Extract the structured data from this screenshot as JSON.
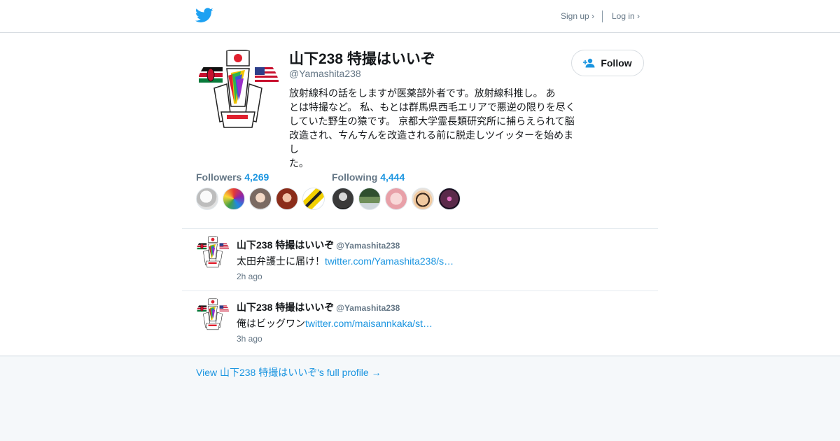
{
  "header": {
    "logo_icon": "twitter-bird-icon",
    "signup_label": "Sign up ›",
    "login_label": "Log in ›"
  },
  "profile": {
    "display_name": "山下238 特撮はいいぞ",
    "screen_name": "@Yamashita238",
    "follow_label": "Follow",
    "follow_icon": "add-person-icon",
    "bio_lines": [
      "放射線科の話をしますが医薬部外者です。放射線科推し。 あ",
      "とは特撮など。 私、もとは群馬県西毛エリアで悪逆の限りを尽く",
      "していた野生の猿です。 京都大学霊長類研究所に捕らえられて脳",
      "改造され、ㄘんㄘんを改造される前に脱走しツイッターを始めまし",
      "た。"
    ]
  },
  "stats": {
    "followers_label": "Followers",
    "followers_count": "4,269",
    "following_label": "Following",
    "following_count": "4,444"
  },
  "tweets": [
    {
      "name": "山下238 特撮はいいぞ",
      "handle": "@Yamashita238",
      "text": "太田弁護士に届け！",
      "link": "twitter.com/Yamashita238/s…",
      "time": "2h ago"
    },
    {
      "name": "山下238 特撮はいいぞ",
      "handle": "@Yamashita238",
      "text": "俺はビッグワン",
      "link": "twitter.com/maisannkaka/st…",
      "time": "3h ago"
    }
  ],
  "footer": {
    "full_profile_link": "View 山下238 特撮はいいぞ's full profile →"
  },
  "colors": {
    "accent": "#1b95e0",
    "background": "#f5f8fa",
    "muted": "#657786"
  }
}
